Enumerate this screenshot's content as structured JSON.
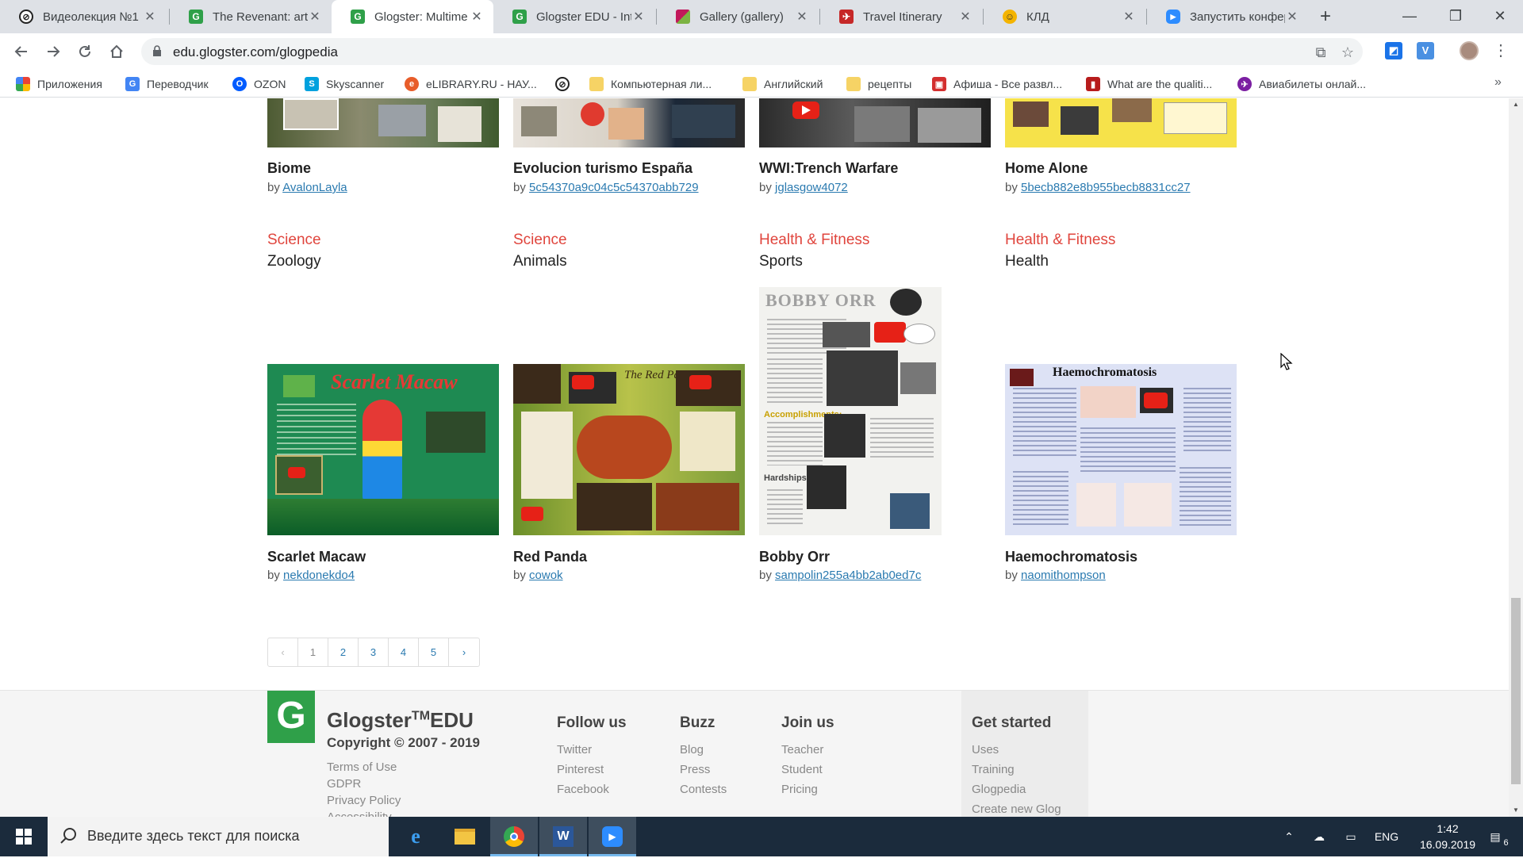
{
  "browser": {
    "tabs": [
      {
        "title": "Видеолекция №1",
        "favicon_color": "#222222",
        "favicon_glyph": "⊘"
      },
      {
        "title": "The Revenant: art",
        "favicon_color": "#2fa049",
        "favicon_glyph": "G"
      },
      {
        "title": "Glogster: Multime",
        "favicon_color": "#2fa049",
        "favicon_glyph": "G",
        "active": true
      },
      {
        "title": "Glogster EDU - Int",
        "favicon_color": "#2fa049",
        "favicon_glyph": "G"
      },
      {
        "title": "Gallery (gallery)",
        "favicon_color": "#c2185b",
        "favicon_glyph": "▦"
      },
      {
        "title": "Travel Itinerary",
        "favicon_color": "#c62828",
        "favicon_glyph": "✈"
      },
      {
        "title": "КЛД",
        "favicon_color": "#f4b400",
        "favicon_glyph": "☺"
      },
      {
        "title": "Запустить конфер",
        "favicon_color": "#2d8cff",
        "favicon_glyph": "▶"
      }
    ],
    "close_glyph": "✕",
    "new_tab_glyph": "+",
    "window_controls": {
      "minimize": "—",
      "restore": "❐",
      "close": "✕"
    },
    "address": "edu.glogster.com/glogpedia",
    "bookmarks": [
      {
        "label": "Приложения",
        "icon_color": "#4285f4",
        "glyph": "⋮⋮"
      },
      {
        "label": "Переводчик",
        "icon_color": "#4285f4",
        "glyph": "G"
      },
      {
        "label": "OZON",
        "icon_color": "#005bff",
        "glyph": "O"
      },
      {
        "label": "Skyscanner",
        "icon_color": "#00a1de",
        "glyph": "S"
      },
      {
        "label": "eLIBRARY.RU - НАУ...",
        "icon_color": "#e85d2a",
        "glyph": "e"
      },
      {
        "label": "",
        "icon_color": "#222222",
        "glyph": "⊘"
      },
      {
        "label": "Компьютерная ли...",
        "icon_color": "#f6d365",
        "glyph": ""
      },
      {
        "label": "Английский",
        "icon_color": "#f6d365",
        "glyph": ""
      },
      {
        "label": "рецепты",
        "icon_color": "#f6d365",
        "glyph": ""
      },
      {
        "label": "Афиша - Все развл...",
        "icon_color": "#d32f2f",
        "glyph": "▣"
      },
      {
        "label": "What are the qualiti...",
        "icon_color": "#b71c1c",
        "glyph": "▮"
      },
      {
        "label": "Авиабилеты онлай...",
        "icon_color": "#7b1fa2",
        "glyph": "✈"
      }
    ],
    "bookmarks_more": "»"
  },
  "page": {
    "top_row": [
      {
        "title": "Biome",
        "by": "by",
        "author": "AvalonLayla",
        "category": "Science",
        "subcategory": "Zoology"
      },
      {
        "title": "Evolucion turismo España",
        "by": "by",
        "author": "5c54370a9c04c5c54370abb729",
        "category": "Science",
        "subcategory": "Animals"
      },
      {
        "title": "WWI:Trench Warfare",
        "by": "by",
        "author": "jglasgow4072",
        "category": "Health & Fitness",
        "subcategory": "Sports"
      },
      {
        "title": "Home Alone",
        "by": "by",
        "author": "5becb882e8b955becb8831cc27",
        "category": "Health & Fitness",
        "subcategory": "Health"
      }
    ],
    "bottom_row": [
      {
        "title": "Scarlet Macaw",
        "by": "by",
        "author": "nekdonekdo4",
        "thumb_text": "Scarlet Macaw"
      },
      {
        "title": "Red Panda",
        "by": "by",
        "author": "cowok",
        "thumb_text": "The Red Panda"
      },
      {
        "title": "Bobby Orr",
        "by": "by",
        "author": "sampolin255a4bb2ab0ed7c",
        "thumb_text": "BOBBY ORR"
      },
      {
        "title": "Haemochromatosis",
        "by": "by",
        "author": "naomithompson",
        "thumb_text": "Haemochromatosis"
      }
    ],
    "pagination": {
      "prev": "‹",
      "pages": [
        "1",
        "2",
        "3",
        "4",
        "5"
      ],
      "current": "1",
      "next": "›"
    }
  },
  "footer": {
    "logo_letter": "G",
    "brand": "Glogster",
    "brand_tm": "TM",
    "brand_suffix": "EDU",
    "copyright": "Copyright © 2007 - 2019",
    "legal_links": [
      "Terms of Use",
      "GDPR",
      "Privacy Policy",
      "Accessibility"
    ],
    "columns": [
      {
        "heading": "Follow us",
        "links": [
          "Twitter",
          "Pinterest",
          "Facebook"
        ]
      },
      {
        "heading": "Buzz",
        "links": [
          "Blog",
          "Press",
          "Contests"
        ]
      },
      {
        "heading": "Join us",
        "links": [
          "Teacher",
          "Student",
          "Pricing"
        ]
      },
      {
        "heading": "Get started",
        "links": [
          "Uses",
          "Training",
          "Glogpedia",
          "Create new Glog"
        ]
      }
    ]
  },
  "taskbar": {
    "search_placeholder": "Введите здесь текст для поиска",
    "language": "ENG",
    "time": "1:42",
    "date": "16.09.2019",
    "notifications": "6"
  },
  "colors": {
    "category": "#e0453d",
    "link": "#2a7ab0",
    "glogster_green": "#2fa049"
  }
}
